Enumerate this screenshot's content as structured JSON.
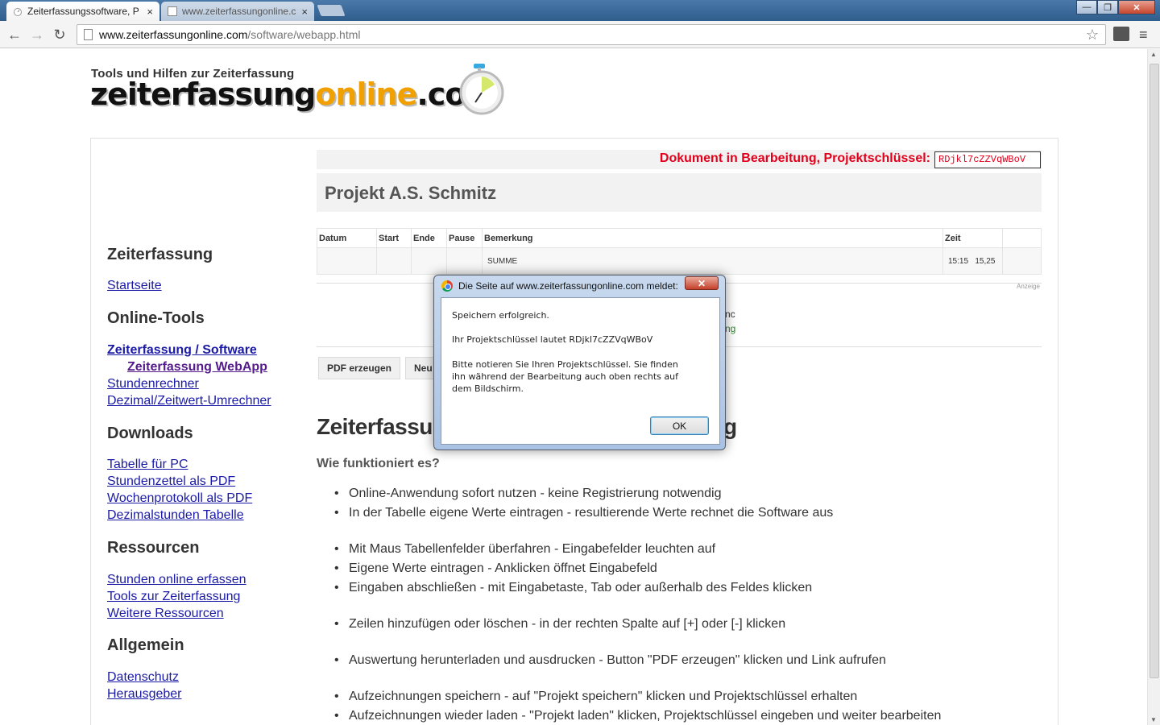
{
  "browser": {
    "tabs": [
      {
        "title": "Zeiterfassungssoftware, P",
        "close": "×"
      },
      {
        "title": "www.zeiterfassungonline.c",
        "close": "×"
      }
    ],
    "window_buttons": {
      "minimize": "—",
      "maximize": "❐",
      "close": "✕"
    },
    "nav": {
      "back": "←",
      "forward": "→",
      "reload": "↻"
    },
    "url_host": "www.zeiterfassungonline.com",
    "url_path": "/software/webapp.html",
    "star": "☆",
    "menu": "≡"
  },
  "header": {
    "tagline": "Tools und Hilfen zur Zeiterfassung",
    "logo_part1": "zeiterfassung",
    "logo_part2": "online",
    "logo_part3": ".com"
  },
  "sidebar": {
    "sections": [
      {
        "heading": "Zeiterfassung"
      },
      {
        "heading": "Online-Tools"
      },
      {
        "heading": "Downloads"
      },
      {
        "heading": "Ressourcen"
      },
      {
        "heading": "Allgemein"
      }
    ],
    "links": {
      "startseite": "Startseite",
      "zeiterfassung_software": "Zeiterfassung / Software",
      "zeiterfassung_webapp": "Zeiterfassung WebApp",
      "stundenrechner": "Stundenrechner",
      "dezimal_umrechner": "Dezimal/Zeitwert-Umrechner",
      "tabelle_pc": "Tabelle für PC",
      "stundenzettel_pdf": "Stundenzettel als PDF",
      "wochenprotokoll_pdf": "Wochenprotokoll als PDF",
      "dezimalstunden_tabelle": "Dezimalstunden Tabelle",
      "stunden_online": "Stunden online erfassen",
      "tools_zeiterfassung": "Tools zur Zeiterfassung",
      "weitere_ressourcen": "Weitere Ressourcen",
      "datenschutz": "Datenschutz",
      "herausgeber": "Herausgeber"
    }
  },
  "status": {
    "label": "Dokument in Bearbeitung, Projektschlüssel:",
    "key": "RDjkl7cZZVqWBoV"
  },
  "project": {
    "title": "Projekt A.S. Schmitz"
  },
  "table": {
    "headers": [
      "Datum",
      "Start",
      "Ende",
      "Pause",
      "Bemerkung",
      "Zeit",
      ""
    ],
    "summary_row": [
      "",
      "",
      "",
      "",
      "SUMME",
      "15:15   15,25",
      ""
    ]
  },
  "ad_label": "Anzeige",
  "partial_text": {
    "line1": "nc",
    "line2": "ng"
  },
  "buttons": {
    "pdf": "PDF erzeugen",
    "neu": "Neu"
  },
  "main": {
    "heading": "Zeiterfassung",
    "heading_tail": "g",
    "subheading": "Wie funktioniert es?",
    "features": [
      "Online-Anwendung sofort nutzen - keine Registrierung notwendig",
      "In der Tabelle eigene Werte eintragen - resultierende Werte rechnet die Software aus",
      "Mit Maus Tabellenfelder überfahren - Eingabefelder leuchten auf",
      "Eigene Werte eintragen - Anklicken öffnet Eingabefeld",
      "Eingaben abschließen - mit Eingabetaste, Tab oder außerhalb des Feldes klicken",
      "Zeilen hinzufügen oder löschen - in der rechten Spalte auf [+] oder [-] klicken",
      "Auswertung herunterladen und ausdrucken - Button \"PDF erzeugen\" klicken und Link aufrufen",
      "Aufzeichnungen speichern - auf \"Projekt speichern\" klicken und Projektschlüssel erhalten",
      "Aufzeichnungen wieder laden - \"Projekt laden\" klicken, Projektschlüssel eingeben und weiter bearbeiten"
    ]
  },
  "dialog": {
    "title": "Die Seite auf www.zeiterfassungonline.com meldet:",
    "close": "✕",
    "line1": "Speichern erfolgreich.",
    "line2": "Ihr Projektschlüssel lautet RDjkl7cZZVqWBoV",
    "paragraph": "Bitte notieren Sie Ihren Projektschlüssel. Sie finden ihn während der Bearbeitung auch oben rechts auf dem Bildschirm.",
    "ok": "OK"
  }
}
